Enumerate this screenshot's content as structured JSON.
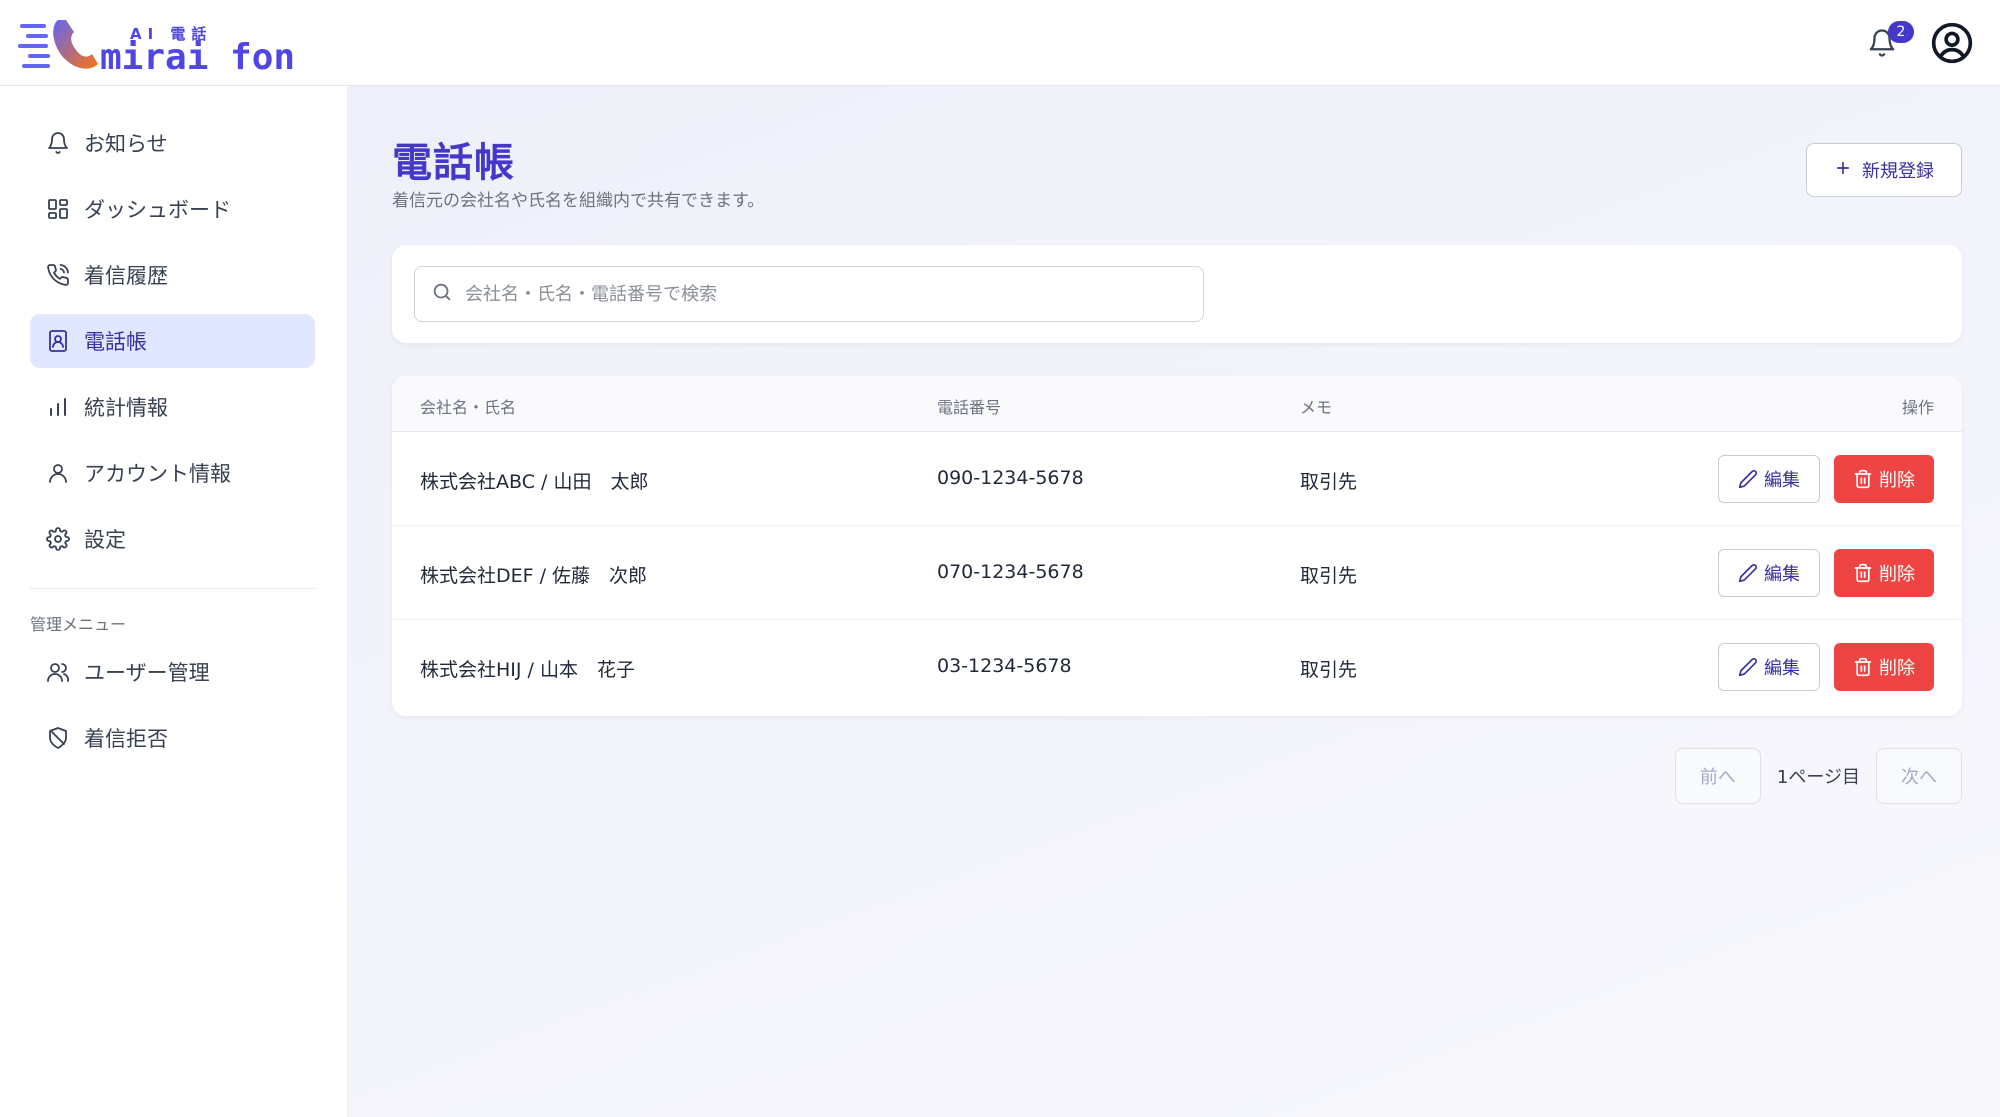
{
  "header": {
    "logo_sub": "AI 電話",
    "logo_main": "mirai fon",
    "notification_count": "2",
    "colors": {
      "brand": "#4f46e5",
      "logo_accent": "#f97316"
    }
  },
  "sidebar": {
    "items": [
      {
        "label": "お知らせ",
        "icon": "bell-icon"
      },
      {
        "label": "ダッシュボード",
        "icon": "grid-icon"
      },
      {
        "label": "着信履歴",
        "icon": "phone-incoming-icon"
      },
      {
        "label": "電話帳",
        "icon": "contact-book-icon",
        "active": true
      },
      {
        "label": "統計情報",
        "icon": "bar-chart-icon"
      },
      {
        "label": "アカウント情報",
        "icon": "user-icon"
      },
      {
        "label": "設定",
        "icon": "gear-icon"
      }
    ],
    "admin_label": "管理メニュー",
    "admin_items": [
      {
        "label": "ユーザー管理",
        "icon": "users-icon"
      },
      {
        "label": "着信拒否",
        "icon": "shield-slash-icon"
      }
    ]
  },
  "main": {
    "title": "電話帳",
    "subtitle": "着信元の会社名や氏名を組織内で共有できます。",
    "new_button": "新規登録",
    "search": {
      "placeholder": "会社名・氏名・電話番号で検索",
      "value": ""
    },
    "table": {
      "headers": {
        "name": "会社名・氏名",
        "phone": "電話番号",
        "memo": "メモ",
        "ops": "操作"
      },
      "rows": [
        {
          "name": "株式会社ABC / 山田　太郎",
          "phone": "090-1234-5678",
          "memo": "取引先"
        },
        {
          "name": "株式会社DEF / 佐藤　次郎",
          "phone": "070-1234-5678",
          "memo": "取引先"
        },
        {
          "name": "株式会社HIJ / 山本　花子",
          "phone": "03-1234-5678",
          "memo": "取引先"
        }
      ],
      "edit_label": "編集",
      "delete_label": "削除",
      "colors": {
        "delete": "#ef4444",
        "edit_text": "#3730a3"
      }
    },
    "pagination": {
      "prev": "前へ",
      "current": "1ページ目",
      "next": "次へ"
    }
  }
}
